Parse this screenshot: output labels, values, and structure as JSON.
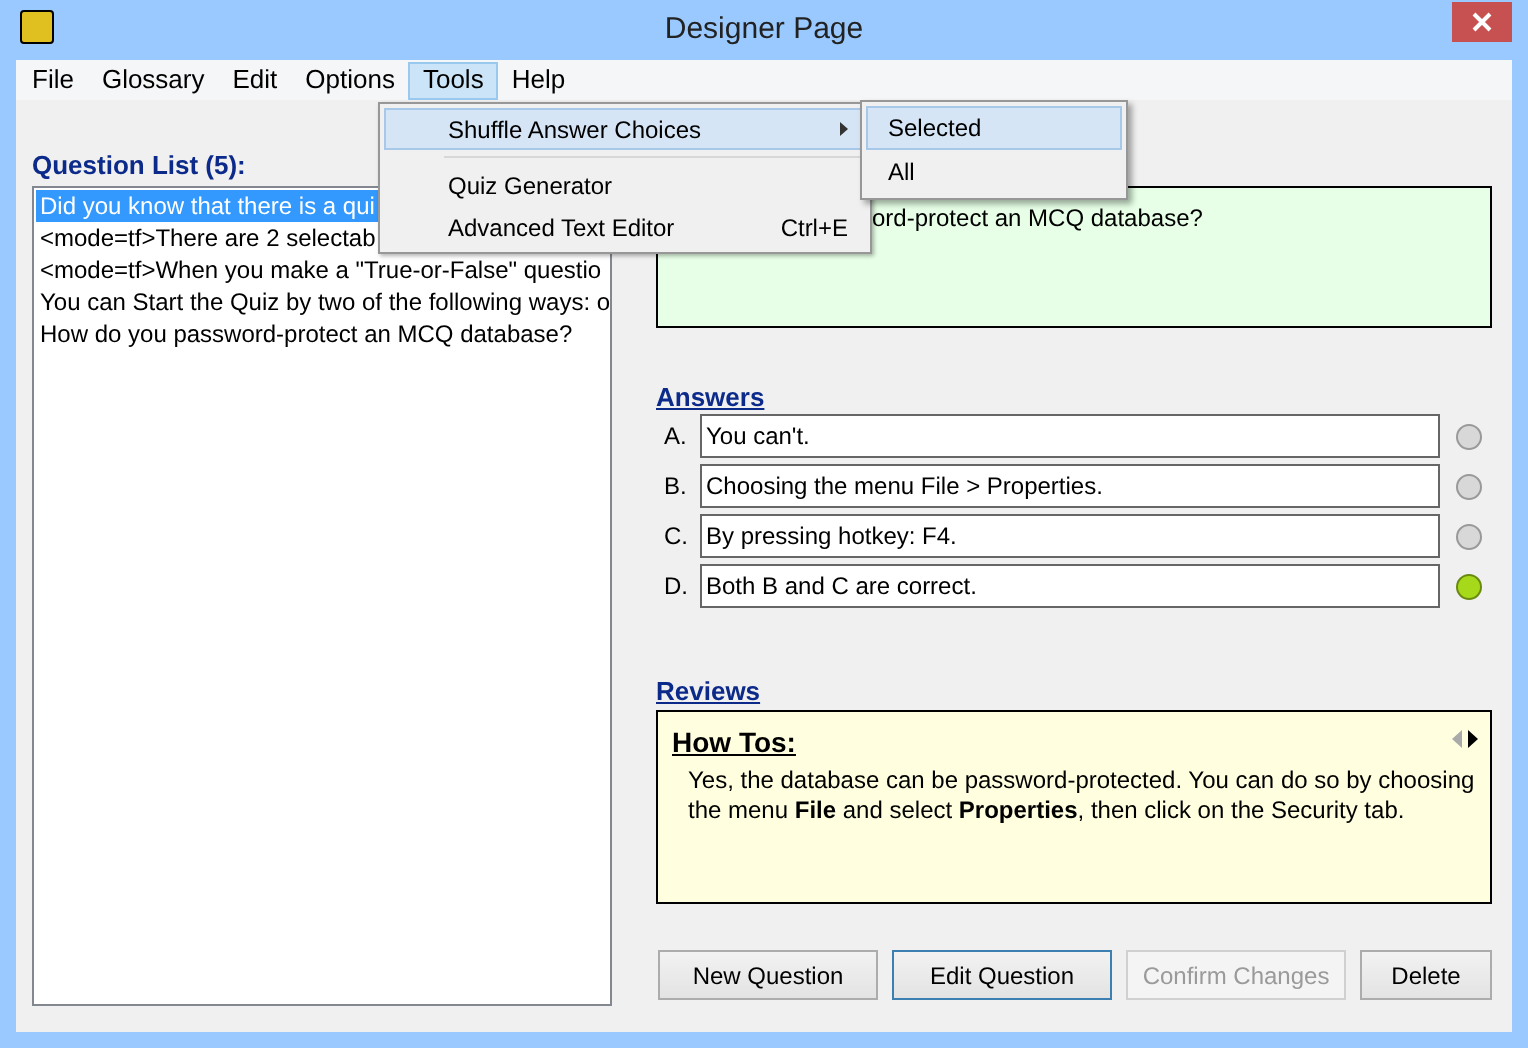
{
  "window": {
    "title": "Designer Page"
  },
  "menu_bar": [
    {
      "label": "File",
      "selected": false
    },
    {
      "label": "Glossary",
      "selected": false
    },
    {
      "label": "Edit",
      "selected": false
    },
    {
      "label": "Options",
      "selected": false
    },
    {
      "label": "Tools",
      "selected": true
    },
    {
      "label": "Help",
      "selected": false
    }
  ],
  "tools_menu": [
    {
      "kind": "item",
      "label": "Shuffle Answer Choices",
      "submenu": true,
      "selected": true
    },
    {
      "kind": "separator"
    },
    {
      "kind": "item",
      "label": "Quiz Generator",
      "submenu": false,
      "selected": false
    },
    {
      "kind": "item",
      "label": "Advanced Text Editor",
      "shortcut": "Ctrl+E",
      "submenu": false,
      "selected": false
    }
  ],
  "submenu": [
    {
      "label": "Selected",
      "selected": true
    },
    {
      "label": "All",
      "selected": false
    }
  ],
  "question_list": {
    "label": "Question List (5):",
    "items": [
      {
        "text": "Did you know that there is a qui",
        "selected": true
      },
      {
        "text": "<mode=tf>There are 2 selectab",
        "selected": false
      },
      {
        "text": "<mode=tf>When you make a \"True-or-False\" questio",
        "selected": false
      },
      {
        "text": "You can Start the Quiz by two of the following ways: o",
        "selected": false
      },
      {
        "text": "How do you password-protect an MCQ database?",
        "selected": false
      }
    ]
  },
  "question": {
    "text": "ord-protect an MCQ database?"
  },
  "answers": {
    "label": "Answers",
    "items": [
      {
        "letter": "A.",
        "text": "You can't.",
        "correct": false
      },
      {
        "letter": "B.",
        "text": "Choosing the menu File > Properties.",
        "correct": false
      },
      {
        "letter": "C.",
        "text": "By pressing hotkey: F4.",
        "correct": false
      },
      {
        "letter": "D.",
        "text": "Both B and C are correct.",
        "correct": true
      }
    ]
  },
  "reviews": {
    "label": "Reviews",
    "heading": "How Tos:",
    "body": "Yes, the database can be password-protected. You can do so by choosing the menu **File** and select **Properties**, then click on the Security tab.",
    "prev_enabled": false,
    "next_enabled": true
  },
  "buttons": [
    {
      "label": "New Question",
      "disabled": false,
      "focused": false
    },
    {
      "label": "Edit Question",
      "disabled": false,
      "focused": true
    },
    {
      "label": "Confirm Changes",
      "disabled": true,
      "focused": false
    },
    {
      "label": "Delete",
      "disabled": false,
      "focused": false
    }
  ]
}
